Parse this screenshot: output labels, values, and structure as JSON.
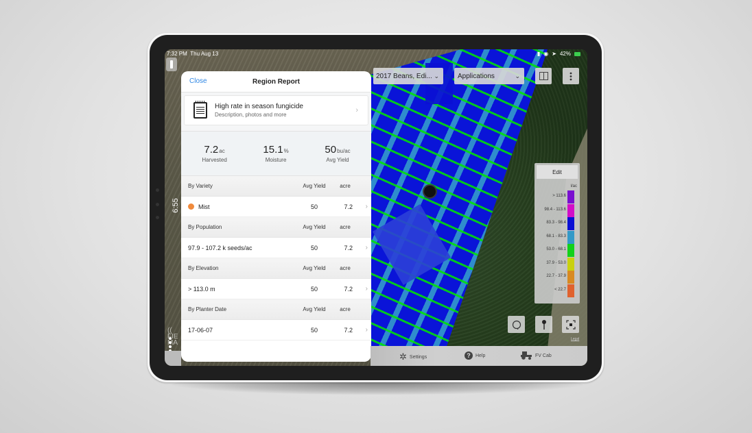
{
  "status_bar": {
    "time": "7:32 PM",
    "date": "Thu Aug 13",
    "battery": "42%"
  },
  "side_timer": "6:55",
  "panel": {
    "close_label": "Close",
    "title": "Region Report",
    "note": {
      "title": "High rate in season fungicide",
      "subtitle": "Description, photos and more",
      "icon": "notepad-icon"
    },
    "stats": [
      {
        "value": "7.2",
        "unit": "ac",
        "label": "Harvested"
      },
      {
        "value": "15.1",
        "unit": "%",
        "label": "Moisture"
      },
      {
        "value": "50",
        "unit": "bu/ac",
        "label": "Avg Yield"
      }
    ],
    "sections": [
      {
        "header": "By Variety",
        "col_yield": "Avg Yield",
        "col_acre": "acre",
        "row": {
          "label": "Mist",
          "swatch_color": "#f08a3c",
          "avg_yield": "50",
          "acre": "7.2"
        }
      },
      {
        "header": "By Population",
        "col_yield": "Avg Yield",
        "col_acre": "acre",
        "row": {
          "label": "97.9 - 107.2 k seeds/ac",
          "avg_yield": "50",
          "acre": "7.2"
        }
      },
      {
        "header": "By Elevation",
        "col_yield": "Avg Yield",
        "col_acre": "acre",
        "row": {
          "label": "> 113.0 m",
          "avg_yield": "50",
          "acre": "7.2"
        }
      },
      {
        "header": "By Planter Date",
        "col_yield": "Avg Yield",
        "col_acre": "acre",
        "row": {
          "label": "17-06-07",
          "avg_yield": "50",
          "acre": "7.2"
        }
      }
    ]
  },
  "toolbar": {
    "field_select": "2017 Beans, Edi...",
    "layer_select": "Applications",
    "split_view_icon": "split-view-icon",
    "more_icon": "more-vertical-icon"
  },
  "legend": {
    "edit_label": "Edit",
    "unit": "l/ac",
    "items": [
      {
        "label": "> 113.6",
        "color": "#7a0fd0"
      },
      {
        "label": "98.4 - 113.6",
        "color": "#d20fc8"
      },
      {
        "label": "83.3 - 98.4",
        "color": "#0a0fd4"
      },
      {
        "label": "68.1 - 83.3",
        "color": "#3499c8"
      },
      {
        "label": "53.0 - 68.1",
        "color": "#12d11a"
      },
      {
        "label": "37.9 - 53.0",
        "color": "#c9d00f"
      },
      {
        "label": "22.7 - 37.9",
        "color": "#d88a22"
      },
      {
        "label": "< 22.7",
        "color": "#e0622e"
      }
    ]
  },
  "map_controls": {
    "lasso_icon": "lasso-icon",
    "pin_icon": "pin-icon",
    "fit_icon": "fit-extent-icon",
    "legal_label": "Legal"
  },
  "bottom_bar": [
    {
      "label": "Settings",
      "icon": "gear-icon"
    },
    {
      "label": "Help",
      "icon": "help-icon"
    },
    {
      "label": "FV Cab",
      "icon": "tractor-icon"
    }
  ]
}
